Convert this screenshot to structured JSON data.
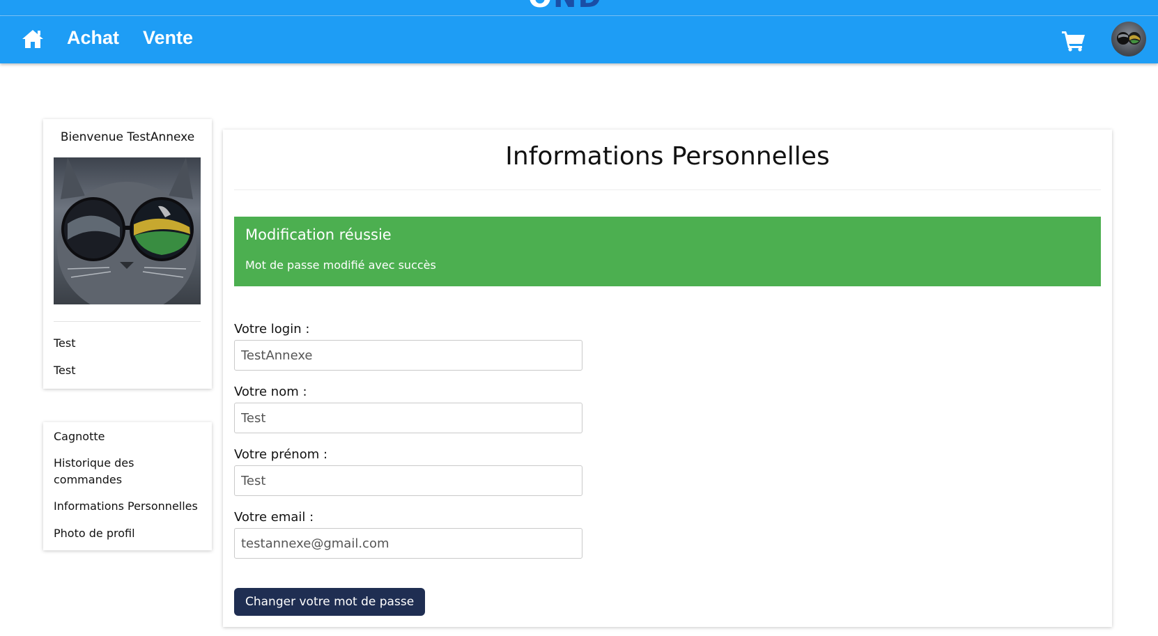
{
  "header": {
    "nav_links": [
      "Achat",
      "Vente"
    ],
    "home_icon": "home-icon",
    "cart_icon": "shopping-cart-icon",
    "avatar": "user-avatar",
    "brand_color": "#1e9df5"
  },
  "sidebar": {
    "welcome": "Bienvenue TestAnnexe",
    "first_name": "Test",
    "last_name": "Test",
    "menu": [
      "Cagnotte",
      "Historique des commandes",
      "Informations Personnelles",
      "Photo de profil"
    ]
  },
  "main": {
    "title": "Informations Personnelles",
    "alert": {
      "title": "Modification réussie",
      "message": "Mot de passe modifié avec succès",
      "color": "#4caf50"
    },
    "fields": [
      {
        "label": "Votre login :",
        "value": "TestAnnexe"
      },
      {
        "label": "Votre nom :",
        "value": "Test"
      },
      {
        "label": "Votre prénom :",
        "value": "Test"
      },
      {
        "label": "Votre email :",
        "value": "testannexe@gmail.com"
      }
    ],
    "button": "Changer votre mot de passe",
    "button_color": "#1f2e52"
  }
}
